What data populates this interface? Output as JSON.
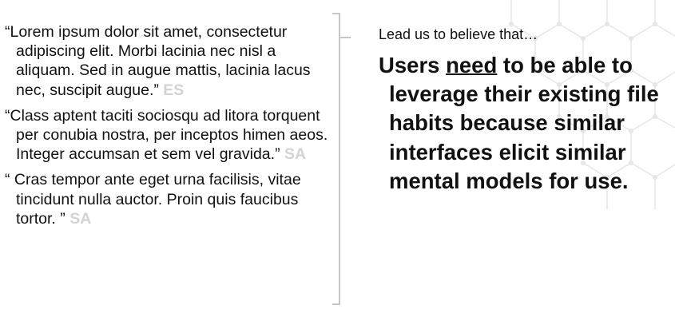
{
  "quotes": [
    {
      "text": "“Lorem ipsum dolor sit amet, consectetur adipiscing elit. Morbi lacinia nec nisl a aliquam. Sed in augue mattis, lacinia lacus nec, suscipit augue.”",
      "initials": "ES"
    },
    {
      "text": "“Class aptent taciti sociosqu ad litora torquent per conubia nostra, per inceptos himen aeos. Integer accumsan et sem vel gravida.”",
      "initials": "SA"
    },
    {
      "text": "“ Cras tempor ante eget urna facilisis, vitae tincidunt nulla auctor. Proin quis faucibus tortor. ”",
      "initials": "SA"
    }
  ],
  "lead_text": "Lead us to believe that…",
  "claim": {
    "prefix": "Users ",
    "emphasis": "need",
    "suffix": " to be able to leverage their existing file habits because similar interfaces elicit similar mental models for use."
  },
  "colors": {
    "initials": "#d3d3d3",
    "bracket": "#c6c6c6",
    "hex_pattern": "#e6e6e6"
  }
}
